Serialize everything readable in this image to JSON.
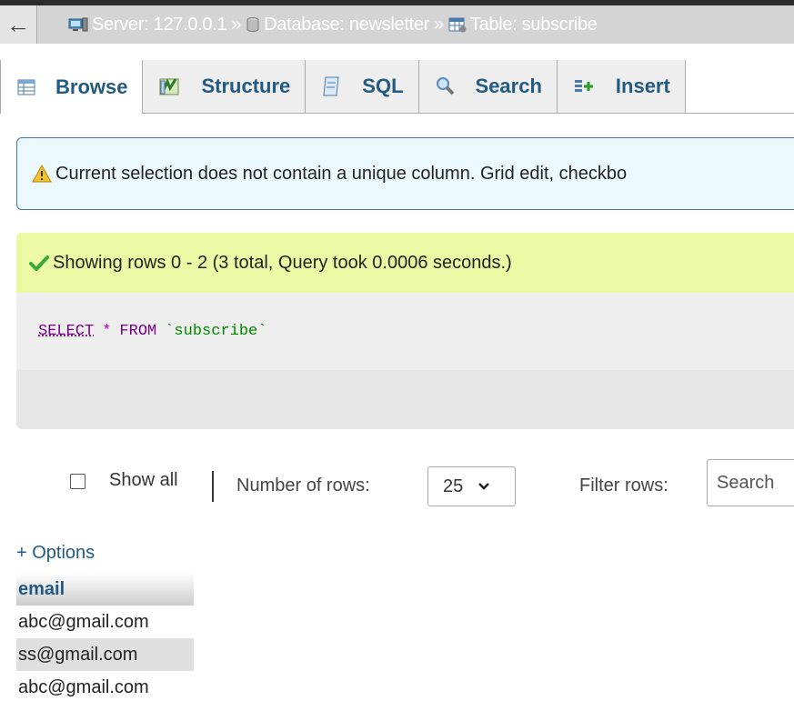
{
  "breadcrumb": {
    "server_label": "Server: 127.0.0.1",
    "database_label": "Database: newsletter",
    "table_label": "Table: subscribe",
    "separator": "»"
  },
  "tabs": [
    {
      "label": "Browse",
      "icon": "browse-icon"
    },
    {
      "label": "Structure",
      "icon": "structure-icon"
    },
    {
      "label": "SQL",
      "icon": "sql-icon"
    },
    {
      "label": "Search",
      "icon": "search-icon"
    },
    {
      "label": "Insert",
      "icon": "insert-icon"
    }
  ],
  "notice": {
    "text": "Current selection does not contain a unique column. Grid edit, checkbo"
  },
  "result": {
    "message": "Showing rows 0 - 2 (3 total, Query took 0.0006 seconds.)",
    "sql": {
      "select": "SELECT",
      "star": "*",
      "from": "FROM",
      "table": "`subscribe`"
    }
  },
  "controls": {
    "show_all_label": "Show all",
    "number_of_rows_label": "Number of rows:",
    "number_of_rows_value": "25",
    "filter_rows_label": "Filter rows:",
    "filter_placeholder": "Search"
  },
  "options_label": "+ Options",
  "table": {
    "column": "email",
    "rows": [
      "abc@gmail.com",
      "ss@gmail.com",
      "abc@gmail.com"
    ]
  },
  "colors": {
    "accent": "#235a81",
    "notice_bg": "#ebf8fd",
    "success_bg": "#ebf8a4",
    "sql_keyword": "#770088"
  }
}
